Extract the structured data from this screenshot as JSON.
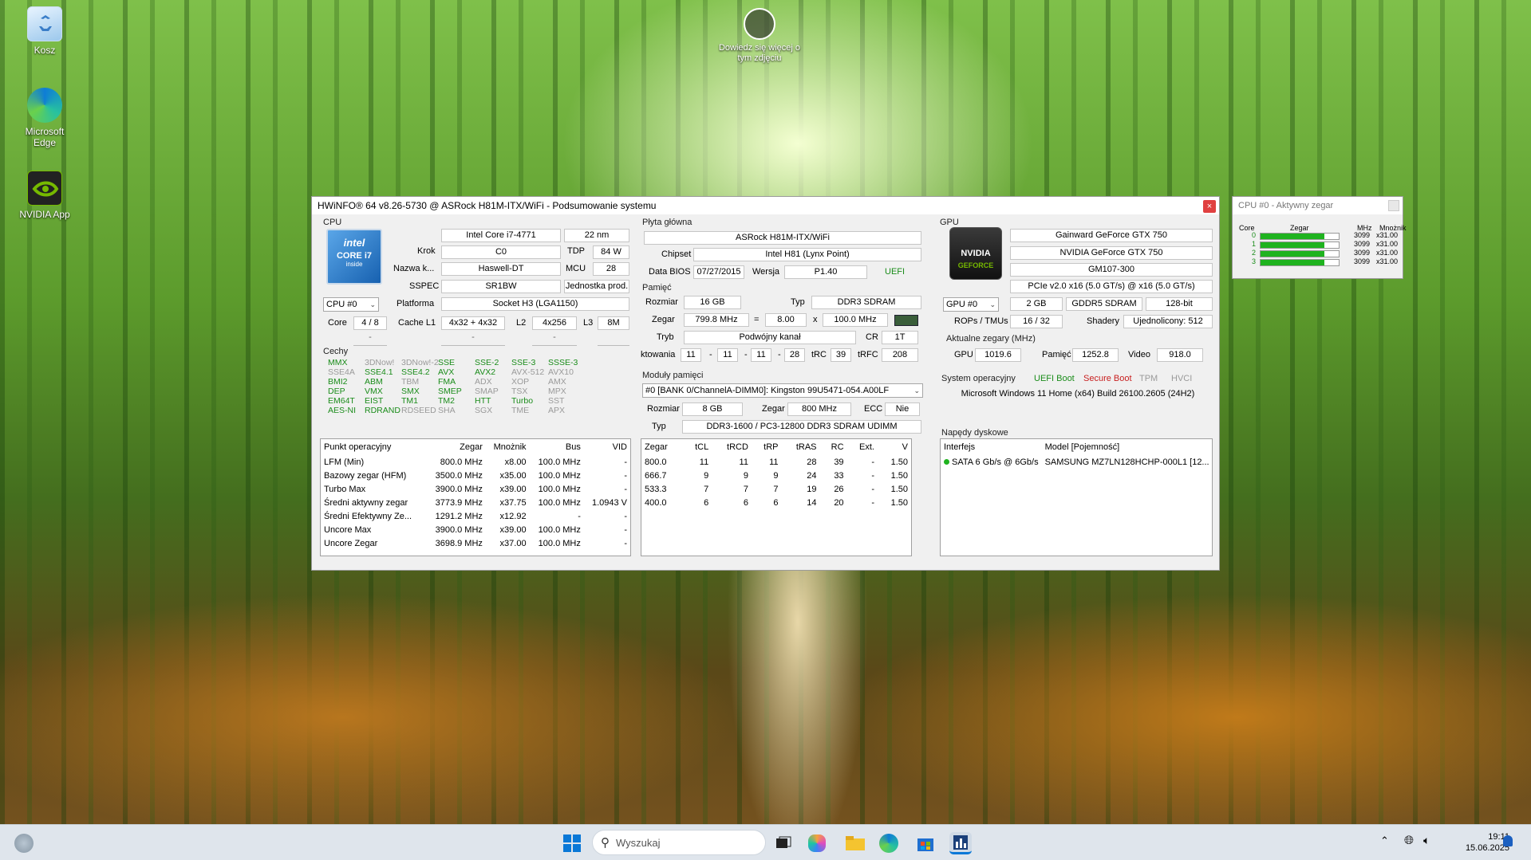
{
  "desktop": {
    "recycle_label": "Kosz",
    "edge_label": "Microsoft Edge",
    "nvidia_label": "NVIDIA App",
    "spotlight_label": "Dowiedz się więcej o tym zdjęciu"
  },
  "main": {
    "title": "HWiNFO® 64 v8.26-5730 @ ASRock H81M-ITX/WiFi - Podsumowanie systemu",
    "close": "×",
    "cpu": {
      "section": "CPU",
      "logo_brand": "intel",
      "logo_line1": "CORE i7",
      "logo_line2": "inside",
      "name": "Intel Core i7-4771",
      "process": "22 nm",
      "krok_label": "Krok",
      "krok": "C0",
      "tdp_label": "TDP",
      "tdp": "84 W",
      "codename_label": "Nazwa k...",
      "codename": "Haswell-DT",
      "mcu_label": "MCU",
      "mcu": "28",
      "sspec_label": "SSPEC",
      "sspec": "SR1BW",
      "prod": "Jednostka prod.",
      "selector": "CPU #0",
      "platform_label": "Platforma",
      "platform": "Socket H3 (LGA1150)",
      "core_label": "Core",
      "core": "4 / 8",
      "l1_label": "Cache L1",
      "l1": "4x32 + 4x32",
      "l2_label": "L2",
      "l2": "4x256",
      "l3_label": "L3",
      "l3": "8M",
      "dash": "-",
      "features_label": "Cechy",
      "features": [
        [
          "MMX",
          "3DNow!",
          "3DNow!-2",
          "SSE",
          "SSE-2",
          "SSE-3",
          "SSSE-3"
        ],
        [
          "SSE4A",
          "SSE4.1",
          "SSE4.2",
          "AVX",
          "AVX2",
          "AVX-512",
          "AVX10"
        ],
        [
          "BMI2",
          "ABM",
          "TBM",
          "FMA",
          "ADX",
          "XOP",
          "AMX"
        ],
        [
          "DEP",
          "VMX",
          "SMX",
          "SMEP",
          "SMAP",
          "TSX",
          "MPX"
        ],
        [
          "EM64T",
          "EIST",
          "TM1",
          "TM2",
          "HTT",
          "Turbo",
          "SST"
        ],
        [
          "AES-NI",
          "RDRAND",
          "RDSEED",
          "SHA",
          "SGX",
          "TME",
          "APX"
        ]
      ],
      "features_on": [
        [
          1,
          0,
          0,
          1,
          1,
          1,
          1
        ],
        [
          0,
          1,
          1,
          1,
          1,
          0,
          0
        ],
        [
          1,
          1,
          0,
          1,
          0,
          0,
          0
        ],
        [
          1,
          1,
          1,
          1,
          0,
          0,
          0
        ],
        [
          1,
          1,
          1,
          1,
          1,
          1,
          0
        ],
        [
          1,
          1,
          0,
          0,
          0,
          0,
          0
        ]
      ],
      "op_headers": [
        "Punkt operacyjny",
        "Zegar",
        "Mnożnik",
        "Bus",
        "VID"
      ],
      "op_rows": [
        [
          "LFM (Min)",
          "800.0 MHz",
          "x8.00",
          "100.0 MHz",
          "-"
        ],
        [
          "Bazowy zegar (HFM)",
          "3500.0 MHz",
          "x35.00",
          "100.0 MHz",
          "-"
        ],
        [
          "Turbo Max",
          "3900.0 MHz",
          "x39.00",
          "100.0 MHz",
          "-"
        ],
        [
          "Średni aktywny zegar",
          "3773.9 MHz",
          "x37.75",
          "100.0 MHz",
          "1.0943 V"
        ],
        [
          "Średni Efektywny Ze...",
          "1291.2 MHz",
          "x12.92",
          "-",
          "-"
        ],
        [
          "Uncore Max",
          "3900.0 MHz",
          "x39.00",
          "100.0 MHz",
          "-"
        ],
        [
          "Uncore Zegar",
          "3698.9 MHz",
          "x37.00",
          "100.0 MHz",
          "-"
        ]
      ]
    },
    "mb": {
      "section": "Płyta główna",
      "name": "ASRock H81M-ITX/WiFi",
      "chipset_label": "Chipset",
      "chipset": "Intel H81 (Lynx Point)",
      "bios_label": "Data BIOS",
      "bios_date": "07/27/2015",
      "version_label": "Wersja",
      "version": "P1.40",
      "uefi": "UEFI",
      "mem_section": "Pamięć",
      "size_label": "Rozmiar",
      "size": "16 GB",
      "type_label": "Typ",
      "type": "DDR3 SDRAM",
      "clock_label": "Zegar",
      "clock": "799.8 MHz",
      "eq": "=",
      "mult": "8.00",
      "x": "x",
      "bus": "100.0 MHz",
      "mode_label": "Tryb",
      "mode": "Podwójny kanał",
      "cr_label": "CR",
      "cr": "1T",
      "timing_label": "ktowania",
      "t1": "11",
      "t2": "11",
      "t3": "11",
      "t4": "28",
      "trc_label": "tRC",
      "trc": "39",
      "trfc_label": "tRFC",
      "trfc": "208",
      "modules_section": "Moduły pamięci",
      "module_select": "#0 [BANK 0/ChannelA-DIMM0]: Kingston 99U5471-054.A00LF",
      "mod_size_label": "Rozmiar",
      "mod_size": "8 GB",
      "mod_clock_label": "Zegar",
      "mod_clock": "800 MHz",
      "ecc_label": "ECC",
      "ecc": "Nie",
      "mod_type_label": "Typ",
      "mod_type": "DDR3-1600 / PC3-12800 DDR3 SDRAM UDIMM",
      "tim_headers": [
        "Zegar",
        "tCL",
        "tRCD",
        "tRP",
        "tRAS",
        "RC",
        "Ext.",
        "V"
      ],
      "tim_rows": [
        [
          "800.0",
          "11",
          "11",
          "11",
          "28",
          "39",
          "-",
          "1.50"
        ],
        [
          "666.7",
          "9",
          "9",
          "9",
          "24",
          "33",
          "-",
          "1.50"
        ],
        [
          "533.3",
          "7",
          "7",
          "7",
          "19",
          "26",
          "-",
          "1.50"
        ],
        [
          "400.0",
          "6",
          "6",
          "6",
          "14",
          "20",
          "-",
          "1.50"
        ]
      ]
    },
    "gpu": {
      "section": "GPU",
      "logo_brand": "NVIDIA",
      "logo_sub": "GEFORCE",
      "vendor": "Gainward GeForce GTX 750",
      "name": "NVIDIA GeForce GTX 750",
      "chip": "GM107-300",
      "bus": "PCIe v2.0 x16 (5.0 GT/s) @ x16 (5.0 GT/s)",
      "selector": "GPU #0",
      "vram": "2 GB",
      "vram_type": "GDDR5 SDRAM",
      "width": "128-bit",
      "rops_label": "ROPs / TMUs",
      "rops": "16 / 32",
      "shaders_label": "Shadery",
      "shaders": "Ujednolicony: 512",
      "clocks_label": "Aktualne zegary (MHz)",
      "gpu_label": "GPU",
      "gpu_clock": "1019.6",
      "mem_label": "Pamięć",
      "mem_clock": "1252.8",
      "video_label": "Video",
      "video_clock": "918.0",
      "os_label": "System operacyjny",
      "uefi_boot": "UEFI Boot",
      "secure_boot": "Secure Boot",
      "tpm": "TPM",
      "hvci": "HVCI",
      "os": "Microsoft Windows 11 Home (x64) Build 26100.2605 (24H2)",
      "drives_label": "Napędy dyskowe",
      "drive_headers": [
        "Interfejs",
        "Model [Pojemność]"
      ],
      "drive_iface": "SATA 6 Gb/s @ 6Gb/s",
      "drive_model": "SAMSUNG MZ7LN128HCHP-000L1 [12..."
    }
  },
  "clockwin": {
    "title": "CPU #0 - Aktywny zegar",
    "headers": [
      "Core",
      "Zegar",
      "MHz",
      "Mnożnik"
    ],
    "rows": [
      {
        "core": "0",
        "mhz": "3099",
        "mult": "x31.00",
        "fill": 0.82
      },
      {
        "core": "1",
        "mhz": "3099",
        "mult": "x31.00",
        "fill": 0.82
      },
      {
        "core": "2",
        "mhz": "3099",
        "mult": "x31.00",
        "fill": 0.82
      },
      {
        "core": "3",
        "mhz": "3099",
        "mult": "x31.00",
        "fill": 0.82
      }
    ]
  },
  "taskbar": {
    "search_placeholder": "Wyszukaj",
    "time": "19:11",
    "date": "15.06.2025"
  },
  "colors": {
    "accent_green": "#1fb31f",
    "off_gray": "#9a9a9a",
    "secure_red": "#c81e1e",
    "uefi_green": "#1a8c1a"
  }
}
